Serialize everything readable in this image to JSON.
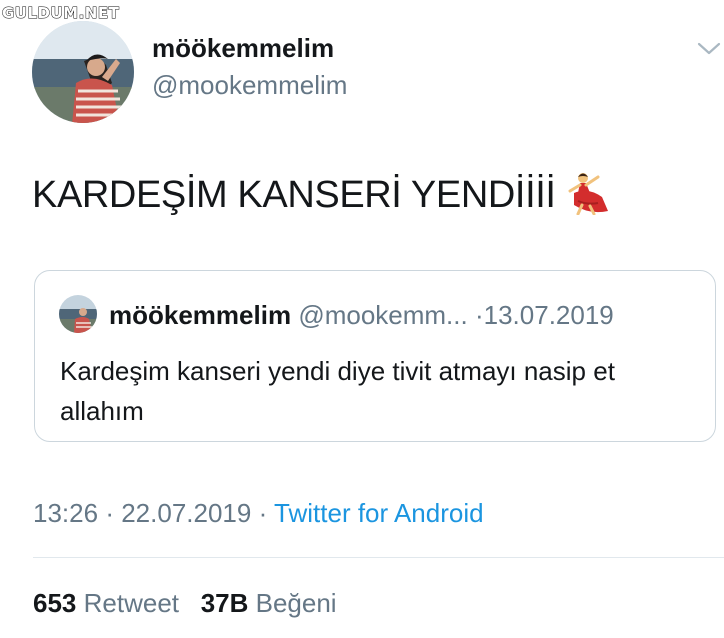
{
  "watermark": "GULDUM.NET",
  "tweet": {
    "display_name": "möökemmelim",
    "handle": "@mookemmelim",
    "text": "KARDEŞİM KANSERİ YENDİİİİ",
    "emoji": "dancer-emoji",
    "time": "13:26",
    "date": "22.07.2019",
    "source": "Twitter for Android",
    "separator": "·"
  },
  "quoted": {
    "display_name": "möökemmelim",
    "handle": "@mookemm...",
    "date": "13.07.2019",
    "separator": "·",
    "text": "Kardeşim kanseri yendi diye tivit atmayı nasip et allahım"
  },
  "stats": {
    "retweets_count": "653",
    "retweets_label": "Retweet",
    "likes_count": "37B",
    "likes_label": "Beğeni"
  },
  "icons": {
    "more": "chevron-down-icon",
    "avatar": "profile-avatar"
  },
  "colors": {
    "text": "#14171a",
    "secondary": "#657786",
    "link": "#1b95e0",
    "border": "#ccd6dd"
  }
}
